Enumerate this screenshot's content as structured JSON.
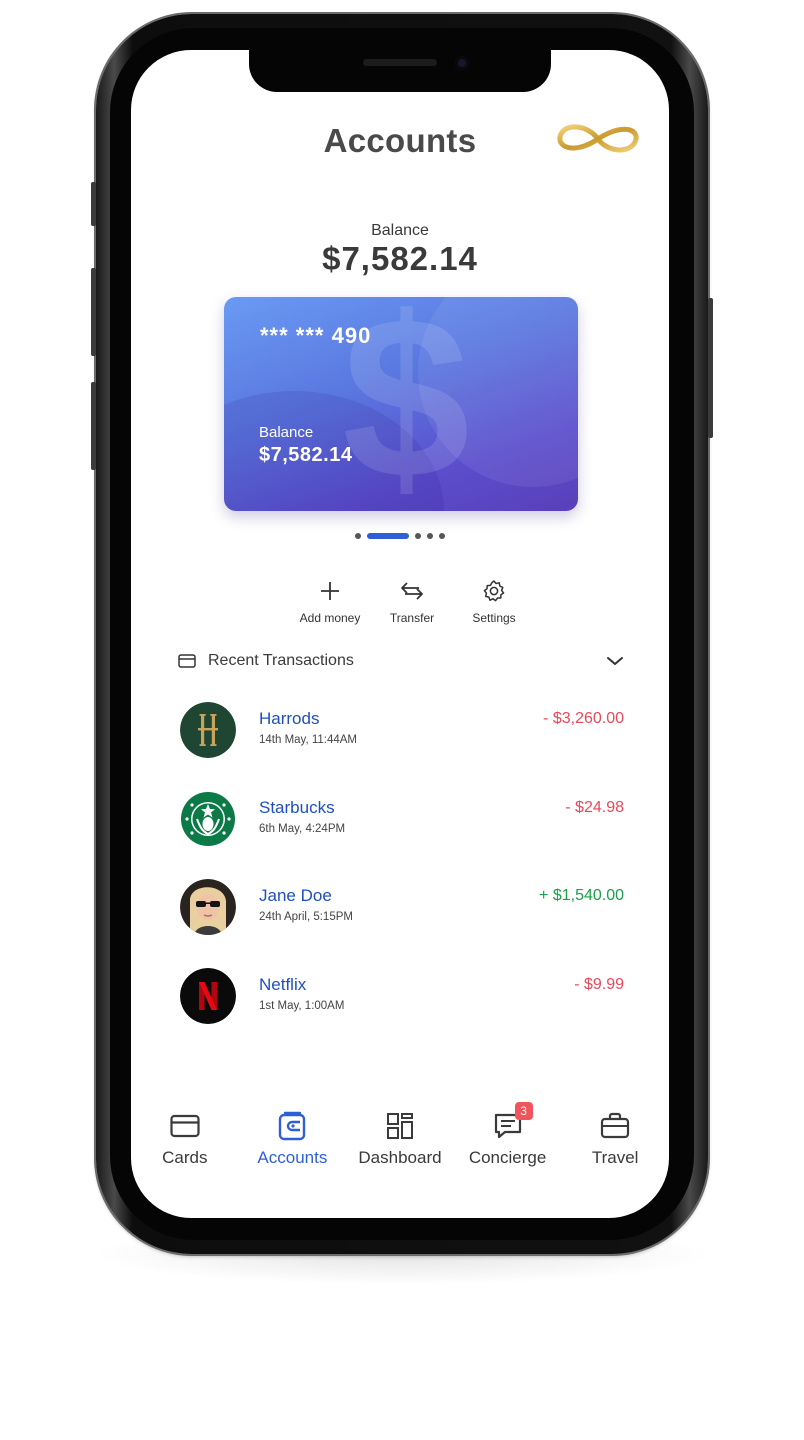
{
  "header": {
    "title": "Accounts",
    "logo_icon": "infinity-logo-icon"
  },
  "balance": {
    "label": "Balance",
    "value": "$7,582.14"
  },
  "card": {
    "number": "*** *** 490",
    "balance_label": "Balance",
    "balance_value": "$7,582.14",
    "pager": {
      "count": 5,
      "active_index": 1
    }
  },
  "actions": [
    {
      "label": "Add money",
      "icon": "plus-icon"
    },
    {
      "label": "Transfer",
      "icon": "transfer-icon"
    },
    {
      "label": "Settings",
      "icon": "gear-icon"
    }
  ],
  "transactions": {
    "title": "Recent Transactions",
    "items": [
      {
        "name": "Harrods",
        "date": "14th May, 11:44AM",
        "amount": "- $3,260.00",
        "type": "debit",
        "avatar": "harrods-logo"
      },
      {
        "name": "Starbucks",
        "date": "6th May, 4:24PM",
        "amount": "- $24.98",
        "type": "debit",
        "avatar": "starbucks-logo"
      },
      {
        "name": "Jane Doe",
        "date": "24th April, 5:15PM",
        "amount": "+ $1,540.00",
        "type": "credit",
        "avatar": "person-photo"
      },
      {
        "name": "Netflix",
        "date": "1st May, 1:00AM",
        "amount": "- $9.99",
        "type": "debit",
        "avatar": "netflix-logo"
      }
    ]
  },
  "nav": {
    "items": [
      {
        "label": "Cards",
        "icon": "card-icon",
        "active": false
      },
      {
        "label": "Accounts",
        "icon": "wallet-icon",
        "active": true
      },
      {
        "label": "Dashboard",
        "icon": "dashboard-icon",
        "active": false
      },
      {
        "label": "Concierge",
        "icon": "chat-icon",
        "active": false,
        "badge": "3"
      },
      {
        "label": "Travel",
        "icon": "briefcase-icon",
        "active": false
      }
    ]
  },
  "colors": {
    "accent": "#2f5fd6",
    "link": "#1f4fc0",
    "debit": "#e8485a",
    "credit": "#19a049",
    "card_gradient_start": "#6a9af3",
    "card_gradient_end": "#5a3fb9",
    "logo_gold": "#d9b24a"
  }
}
